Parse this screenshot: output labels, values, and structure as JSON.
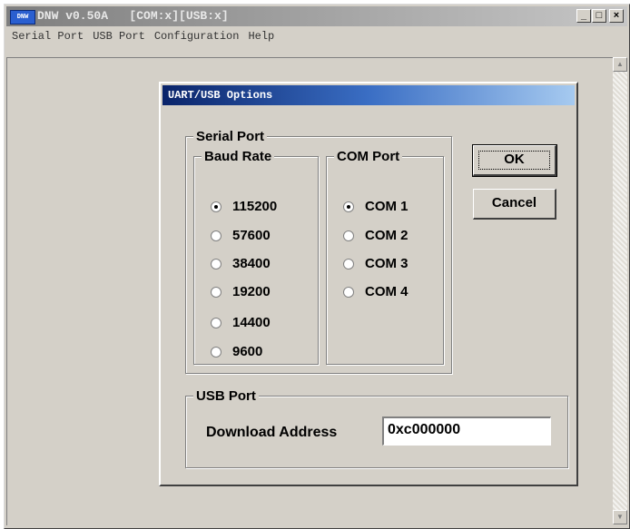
{
  "window": {
    "icon_text": "DNW",
    "title": "DNW v0.50A   [COM:x][USB:x]",
    "minimize": "_",
    "maximize": "□",
    "close": "×"
  },
  "menu": [
    "Serial Port",
    "USB Port",
    "Configuration",
    "Help"
  ],
  "dialog": {
    "title": "UART/USB Options",
    "serial_port_label": "Serial Port",
    "baud_rate_label": "Baud Rate",
    "baud_rates": [
      {
        "label": "115200",
        "selected": true
      },
      {
        "label": "57600",
        "selected": false
      },
      {
        "label": "38400",
        "selected": false
      },
      {
        "label": "19200",
        "selected": false
      },
      {
        "label": "14400",
        "selected": false
      },
      {
        "label": "9600",
        "selected": false
      }
    ],
    "com_port_label": "COM Port",
    "com_ports": [
      {
        "label": "COM 1",
        "selected": true
      },
      {
        "label": "COM 2",
        "selected": false
      },
      {
        "label": "COM 3",
        "selected": false
      },
      {
        "label": "COM 4",
        "selected": false
      }
    ],
    "ok_label": "OK",
    "cancel_label": "Cancel",
    "usb_port_label": "USB Port",
    "download_address_label": "Download Address",
    "download_address_value": "0xc000000"
  },
  "colors": {
    "dialog_title_start": "#0a246a",
    "dialog_title_end": "#a6caf0",
    "face": "#d4d0c8"
  },
  "icons": {
    "scroll_up": "scroll-up-arrow-icon",
    "scroll_down": "scroll-down-arrow-icon"
  }
}
